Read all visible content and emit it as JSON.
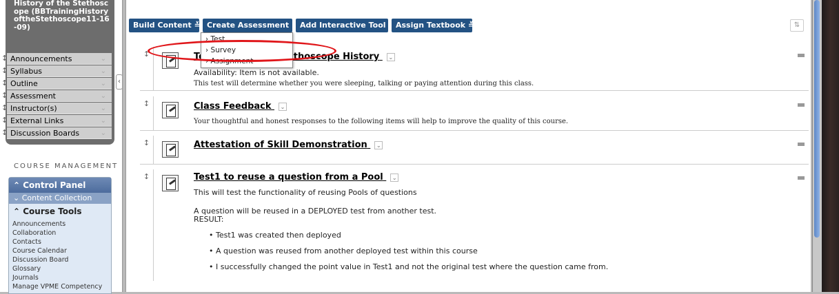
{
  "sidebar": {
    "course_title": "History of the Stethoscope (BBTrainingHistoryoftheStethoscope11-16-09)",
    "menu_items": [
      {
        "label": "Announcements"
      },
      {
        "label": "Syllabus"
      },
      {
        "label": "Outline"
      },
      {
        "label": "Assessment"
      },
      {
        "label": "Instructor(s)"
      },
      {
        "label": "External Links"
      },
      {
        "label": "Discussion Boards"
      }
    ],
    "course_management_label": "COURSE MANAGEMENT",
    "control_panel_label": "Control Panel",
    "content_collection_label": "Content Collection",
    "course_tools_label": "Course Tools",
    "tools": [
      "Announcements",
      "Collaboration",
      "Contacts",
      "Course Calendar",
      "Discussion Board",
      "Glossary",
      "Journals",
      "Manage VPME Competency"
    ]
  },
  "toolbar": {
    "build_content": "Build Content",
    "create_assessment": "Create Assessment",
    "add_interactive_tool": "Add Interactive Tool",
    "assign_textbook": "Assign Textbook"
  },
  "dropdown": {
    "items": [
      "Test",
      "Survey",
      "Assignment"
    ]
  },
  "content_items": [
    {
      "title": "Test",
      "title_tail": "ethoscope History",
      "availability": "Availability:  Item is not available.",
      "description": "This test will determine whether you were sleeping, talking or paying attention during this class."
    },
    {
      "title": "Class Feedback",
      "description": "Your thoughtful and honest responses to the following items will help to improve the quality of this course."
    },
    {
      "title": "Attestation of Skill Demonstration"
    },
    {
      "title": "Test1 to reuse a question from a Pool",
      "line1": "This will test the functionality of reusing Pools of questions",
      "line2": "A question will be reused in a DEPLOYED test from another test.",
      "line3": "RESULT:",
      "bullets": [
        "Test1 was created then deployed",
        "A question was reused from another deployed test within this course",
        "I successfully changed the point value in Test1 and not the original test where the question came from."
      ]
    }
  ],
  "colors": {
    "toolbar_button": "#235283",
    "highlight_oval": "#e0161a",
    "sidebar_box": "#6d6d6d"
  }
}
